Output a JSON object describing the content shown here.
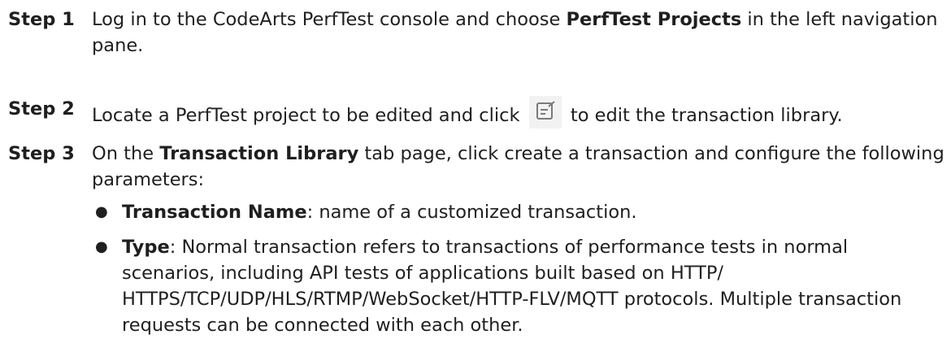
{
  "steps": [
    {
      "label": "Step 1",
      "parts": [
        {
          "text": "Log in to the CodeArts PerfTest console and choose "
        },
        {
          "bold": "PerfTest Projects"
        },
        {
          "text": " in the left navigation pane."
        }
      ]
    },
    {
      "label": "Step 2",
      "before_icon": "Locate a PerfTest project to be edited and click ",
      "icon": "edit-icon",
      "after_icon": " to edit the transaction library."
    },
    {
      "label": "Step 3",
      "parts": [
        {
          "text": "On the "
        },
        {
          "bold": "Transaction Library"
        },
        {
          "text": " tab page, click create a transaction and configure the following parameters:"
        }
      ],
      "bullets": [
        {
          "term": "Transaction Name",
          "desc": ": name of a customized transaction."
        },
        {
          "term": "Type",
          "desc": ": Normal transaction refers to transactions of performance tests in normal scenarios, including API tests of applications built based on HTTP/ HTTPS/TCP/UDP/HLS/RTMP/WebSocket/HTTP-FLV/MQTT protocols. Multiple transaction requests can be connected with each other."
        }
      ]
    }
  ],
  "bullet_glyph": "●"
}
